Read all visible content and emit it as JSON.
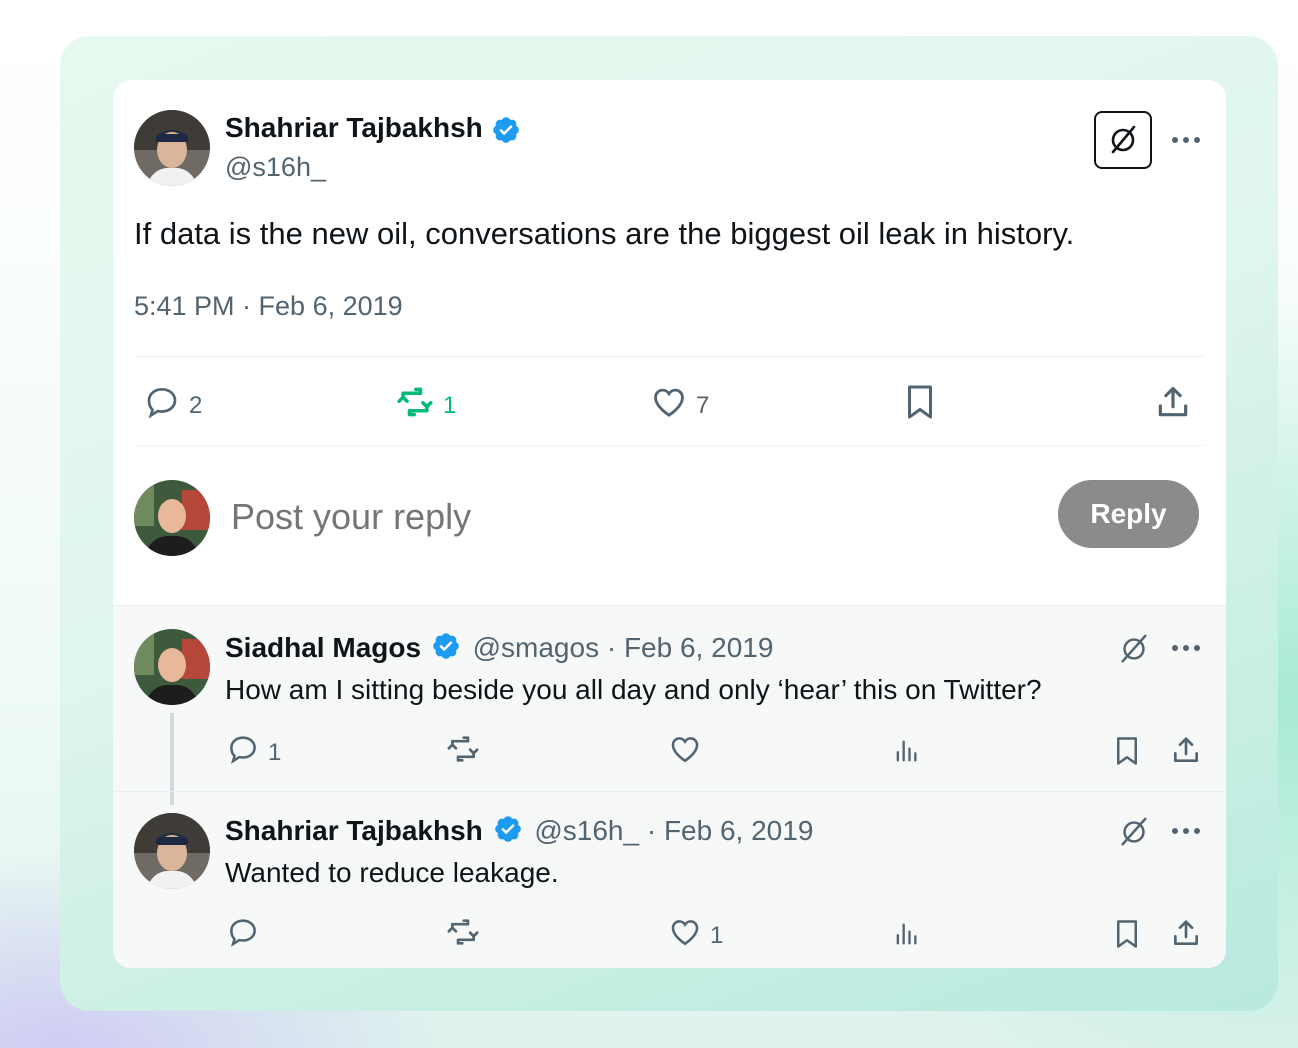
{
  "main_post": {
    "author_name": "Shahriar Tajbakhsh",
    "author_handle": "@s16h_",
    "text": "If data is the new oil, conversations are the biggest oil leak in history.",
    "timestamp": "5:41 PM · Feb 6, 2019",
    "replies_count": "2",
    "reposts_count": "1",
    "likes_count": "7"
  },
  "composer": {
    "placeholder": "Post your reply",
    "reply_button_label": "Reply"
  },
  "replies": [
    {
      "author_name": "Siadhal Magos",
      "meta": "@smagos · Feb 6, 2019",
      "text": "How am I sitting beside you all day and only ‘hear’ this on Twitter?",
      "replies_count": "1",
      "reposts_count": "",
      "likes_count": ""
    },
    {
      "author_name": "Shahriar Tajbakhsh",
      "meta": "@s16h_ · Feb 6, 2019",
      "text": "Wanted to reduce leakage.",
      "replies_count": "",
      "reposts_count": "",
      "likes_count": "1"
    }
  ],
  "colors": {
    "verified": "#1d9bf0",
    "repost_active": "#00ba7c",
    "muted": "#536471",
    "reply_button_bg": "#8b8b8b"
  },
  "icons": [
    "verified-badge-icon",
    "no-leak-icon",
    "more-icon",
    "reply-icon",
    "repost-icon",
    "like-icon",
    "bookmark-icon",
    "share-icon",
    "analytics-icon"
  ]
}
